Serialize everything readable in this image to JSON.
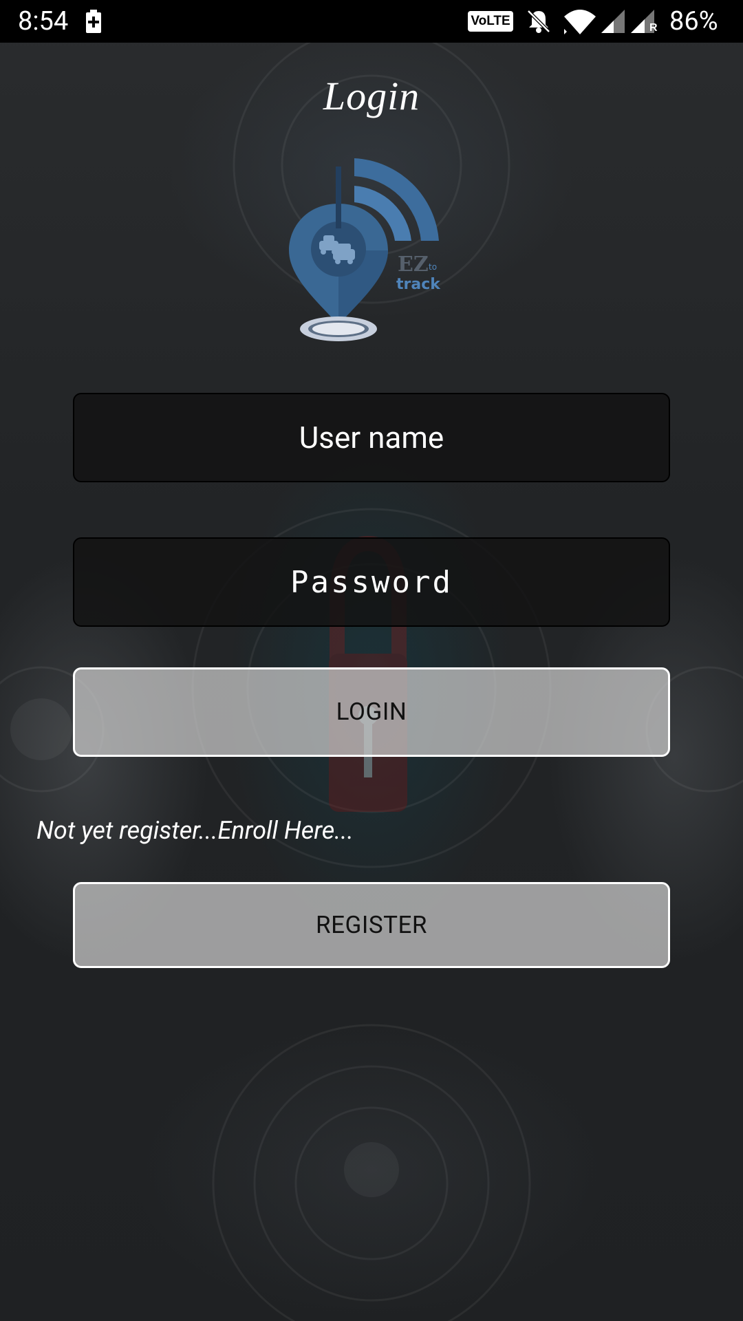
{
  "status_bar": {
    "time": "8:54",
    "volte_label": "VoLTE",
    "roaming_indicator": "R",
    "battery_percent": "86%",
    "icons": [
      "battery-charging-icon",
      "volte-icon",
      "bell-off-icon",
      "wifi-icon",
      "signal-icon",
      "signal-roaming-icon"
    ]
  },
  "header": {
    "title": "Login"
  },
  "logo": {
    "text_ez": "EZ",
    "text_to": "to",
    "text_track": "track",
    "colors": {
      "primary_blue": "#3b6a9a",
      "light_blue": "#5b8fc4",
      "ring": "#c8d0e0"
    }
  },
  "form": {
    "username_placeholder": "User name",
    "username_value": "",
    "password_placeholder": "Password",
    "password_value": "",
    "login_label": "LOGIN",
    "enroll_prompt": "Not yet register...Enroll Here...",
    "register_label": "REGISTER"
  }
}
